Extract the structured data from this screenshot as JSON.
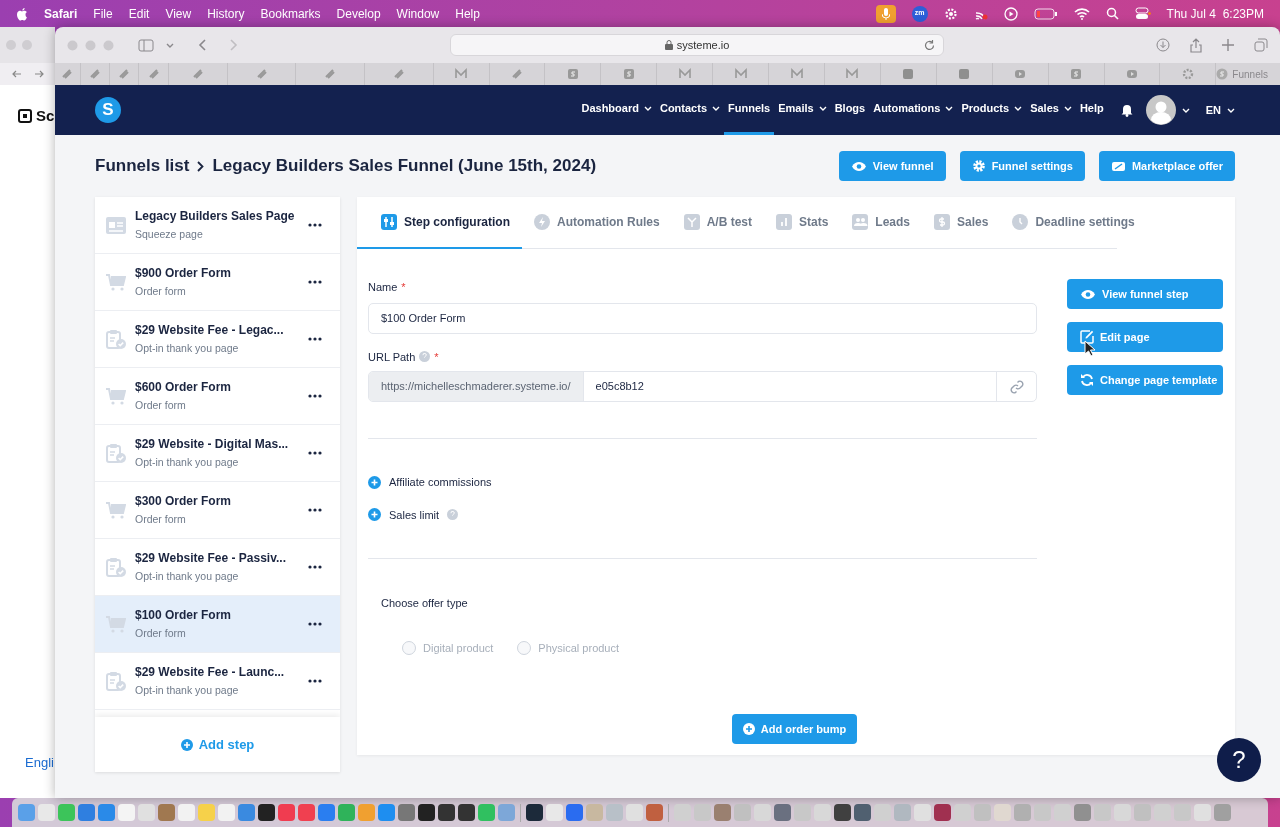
{
  "menubar": {
    "app": "Safari",
    "menus": [
      "File",
      "Edit",
      "View",
      "History",
      "Bookmarks",
      "Develop",
      "Window",
      "Help"
    ],
    "zoom_badge": "zm",
    "clock": "Thu Jul 4  6:23PM"
  },
  "back_window": {
    "logo_text": "Sc",
    "footer_text": "Engli"
  },
  "browser": {
    "address": "systeme.io",
    "tab_title": "Funnels"
  },
  "nav": {
    "logo": "S",
    "items": [
      {
        "label": "Dashboard",
        "dropdown": true,
        "selected": false
      },
      {
        "label": "Contacts",
        "dropdown": true,
        "selected": false
      },
      {
        "label": "Funnels",
        "dropdown": false,
        "selected": true
      },
      {
        "label": "Emails",
        "dropdown": true,
        "selected": false
      },
      {
        "label": "Blogs",
        "dropdown": false,
        "selected": false
      },
      {
        "label": "Automations",
        "dropdown": true,
        "selected": false
      },
      {
        "label": "Products",
        "dropdown": true,
        "selected": false
      },
      {
        "label": "Sales",
        "dropdown": true,
        "selected": false
      },
      {
        "label": "Help",
        "dropdown": false,
        "selected": false
      }
    ],
    "language": "EN"
  },
  "breadcrumb": [
    "Funnels list",
    "Legacy Builders Sales Funnel (June 15th, 2024)"
  ],
  "header_buttons": [
    {
      "label": "View funnel",
      "kind": "eye"
    },
    {
      "label": "Funnel settings",
      "kind": "gear"
    },
    {
      "label": "Marketplace offer",
      "kind": "tag"
    }
  ],
  "steps": [
    {
      "title": "Legacy Builders Sales Page",
      "subtitle": "Squeeze page",
      "kind": "page",
      "selected": false
    },
    {
      "title": "$900 Order Form",
      "subtitle": "Order form",
      "kind": "cart",
      "selected": false
    },
    {
      "title": "$29 Website Fee - Legac...",
      "subtitle": "Opt-in thank you page",
      "kind": "clipboard",
      "selected": false
    },
    {
      "title": "$600 Order Form",
      "subtitle": "Order form",
      "kind": "cart",
      "selected": false
    },
    {
      "title": "$29 Website - Digital Mas...",
      "subtitle": "Opt-in thank you page",
      "kind": "clipboard",
      "selected": false
    },
    {
      "title": "$300 Order Form",
      "subtitle": "Order form",
      "kind": "cart",
      "selected": false
    },
    {
      "title": "$29 Website Fee - Passiv...",
      "subtitle": "Opt-in thank you page",
      "kind": "clipboard",
      "selected": false
    },
    {
      "title": "$100 Order Form",
      "subtitle": "Order form",
      "kind": "cart",
      "selected": true
    },
    {
      "title": "$29 Website Fee - Launc...",
      "subtitle": "Opt-in thank you page",
      "kind": "clipboard",
      "selected": false
    }
  ],
  "add_step": "Add step",
  "tabs": [
    {
      "label": "Step configuration",
      "kind": "sliders",
      "selected": true
    },
    {
      "label": "Automation Rules",
      "kind": "bolt",
      "selected": false
    },
    {
      "label": "A/B test",
      "kind": "split",
      "selected": false
    },
    {
      "label": "Stats",
      "kind": "bars",
      "selected": false
    },
    {
      "label": "Leads",
      "kind": "people",
      "selected": false
    },
    {
      "label": "Sales",
      "kind": "dollar",
      "selected": false
    },
    {
      "label": "Deadline settings",
      "kind": "clock",
      "selected": false
    }
  ],
  "form": {
    "name_label": "Name",
    "name_value": "$100 Order Form",
    "url_label": "URL Path",
    "url_prefix": "https://michelleschmaderer.systeme.io/",
    "url_value": "e05c8b12",
    "required_mark": "*"
  },
  "side_buttons": [
    {
      "label": "View funnel step",
      "kind": "eye"
    },
    {
      "label": "Edit page",
      "kind": "edit"
    },
    {
      "label": "Change page template",
      "kind": "refresh"
    }
  ],
  "toggles": [
    {
      "label": "Affiliate commissions",
      "help": false
    },
    {
      "label": "Sales limit",
      "help": true
    }
  ],
  "offer": {
    "label": "Choose offer type",
    "options": [
      {
        "label": "Digital product",
        "selected": false,
        "disabled": true
      },
      {
        "label": "Physical product",
        "selected": false,
        "disabled": true
      }
    ]
  },
  "add_order_bump": "Add order bump",
  "help_button": "?"
}
